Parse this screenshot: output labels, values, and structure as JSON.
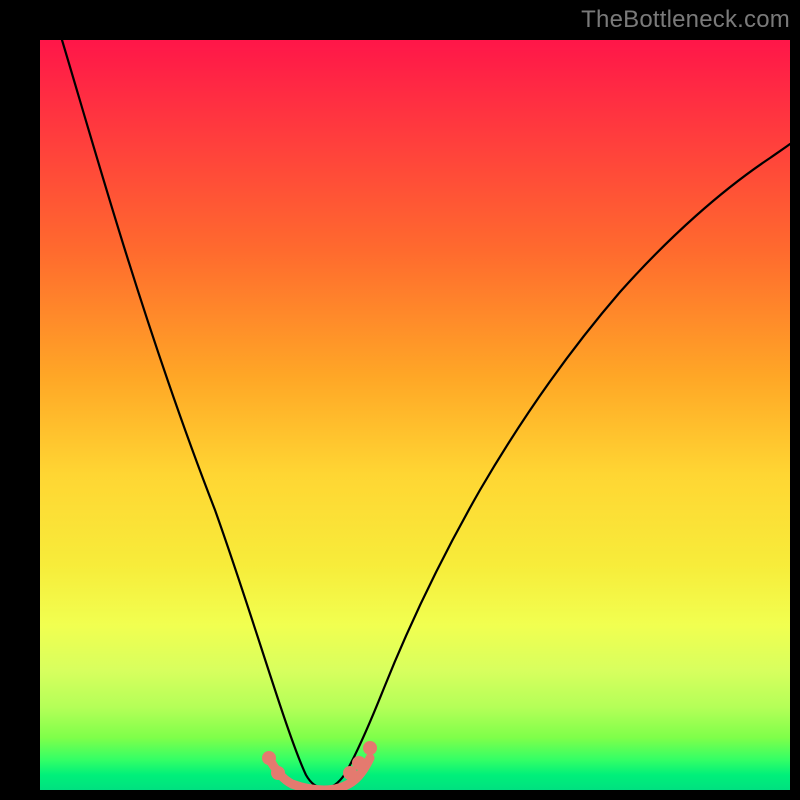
{
  "watermark": "TheBottleneck.com",
  "colors": {
    "accent_marker": "#e47a6f",
    "curve": "#000000"
  },
  "chart_data": {
    "type": "line",
    "title": "",
    "xlabel": "",
    "ylabel": "",
    "xlim": [
      0,
      100
    ],
    "ylim": [
      0,
      100
    ],
    "grid": false,
    "legend": false,
    "description": "Bottleneck curve: y = bottleneck percentage (higher = worse). Single V-shaped curve with minimum (zero bottleneck) around x ≈ 33–40. Left branch enters near top-left, right branch exits near y ≈ 80 on the right edge. A short salmon-colored flat segment with dot markers highlights the near-zero region at the bottom of the V.",
    "series": [
      {
        "name": "bottleneck-curve",
        "x": [
          3,
          6,
          10,
          14,
          18,
          22,
          26,
          29,
          31,
          33,
          35,
          37,
          39,
          41,
          43,
          46,
          50,
          55,
          60,
          66,
          72,
          78,
          84,
          90,
          96,
          100
        ],
        "y": [
          100,
          90,
          77,
          64,
          51,
          38,
          25,
          14,
          7,
          2,
          0,
          0,
          0,
          2,
          6,
          13,
          22,
          33,
          42,
          51,
          59,
          65,
          70,
          74,
          77,
          79
        ]
      }
    ],
    "highlight_segment": {
      "name": "optimal-range",
      "x": [
        30.5,
        32,
        34,
        36,
        38,
        40,
        41.5,
        43
      ],
      "y": [
        4,
        1.5,
        0.5,
        0.3,
        0.5,
        1.5,
        3,
        5.5
      ],
      "marker_points": [
        {
          "x": 30.5,
          "y": 4
        },
        {
          "x": 31.5,
          "y": 2
        },
        {
          "x": 40.5,
          "y": 2
        },
        {
          "x": 41.5,
          "y": 3.5
        },
        {
          "x": 43,
          "y": 5.5
        }
      ]
    }
  }
}
